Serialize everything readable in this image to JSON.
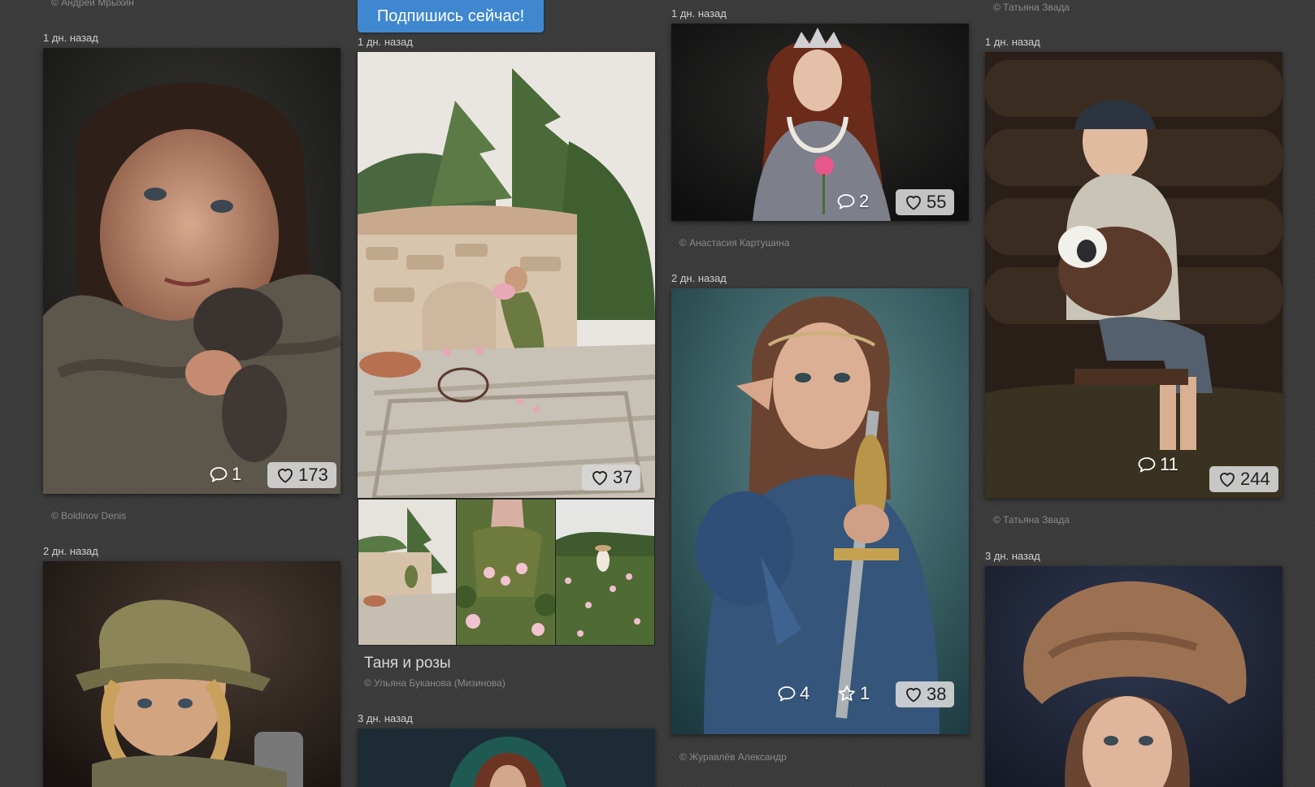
{
  "header": {
    "subscribe_label": "Подпишись сейчас!",
    "top_credit_col1": "© Андрей Мрыхин",
    "top_credit_col4": "© Татьяна Звада"
  },
  "column1": {
    "card1": {
      "date": "1 дн. назад",
      "comments": "1",
      "likes": "173",
      "credit": "© Boldinov Denis"
    },
    "card2": {
      "date": "2 дн. назад"
    }
  },
  "column2": {
    "card1": {
      "date": "1 дн. назад",
      "likes": "37",
      "title": "Таня и розы",
      "credit": "© Ульяна Буканова (Мизинова)"
    },
    "card2": {
      "date": "3 дн. назад"
    }
  },
  "column3": {
    "card1": {
      "date": "1 дн. назад",
      "comments": "2",
      "likes": "55",
      "credit": "© Анастасия Картушина"
    },
    "card2": {
      "date": "2 дн. назад",
      "comments": "4",
      "favorites": "1",
      "likes": "38",
      "credit": "© Журавлёв Александр"
    }
  },
  "column4": {
    "card1": {
      "date": "1 дн. назад",
      "comments": "11",
      "likes": "244",
      "credit": "© Татьяна Звада"
    },
    "card2": {
      "date": "3 дн. назад"
    }
  },
  "icons": {
    "comment": "comment-icon",
    "heart": "heart-icon",
    "star": "star-icon"
  }
}
